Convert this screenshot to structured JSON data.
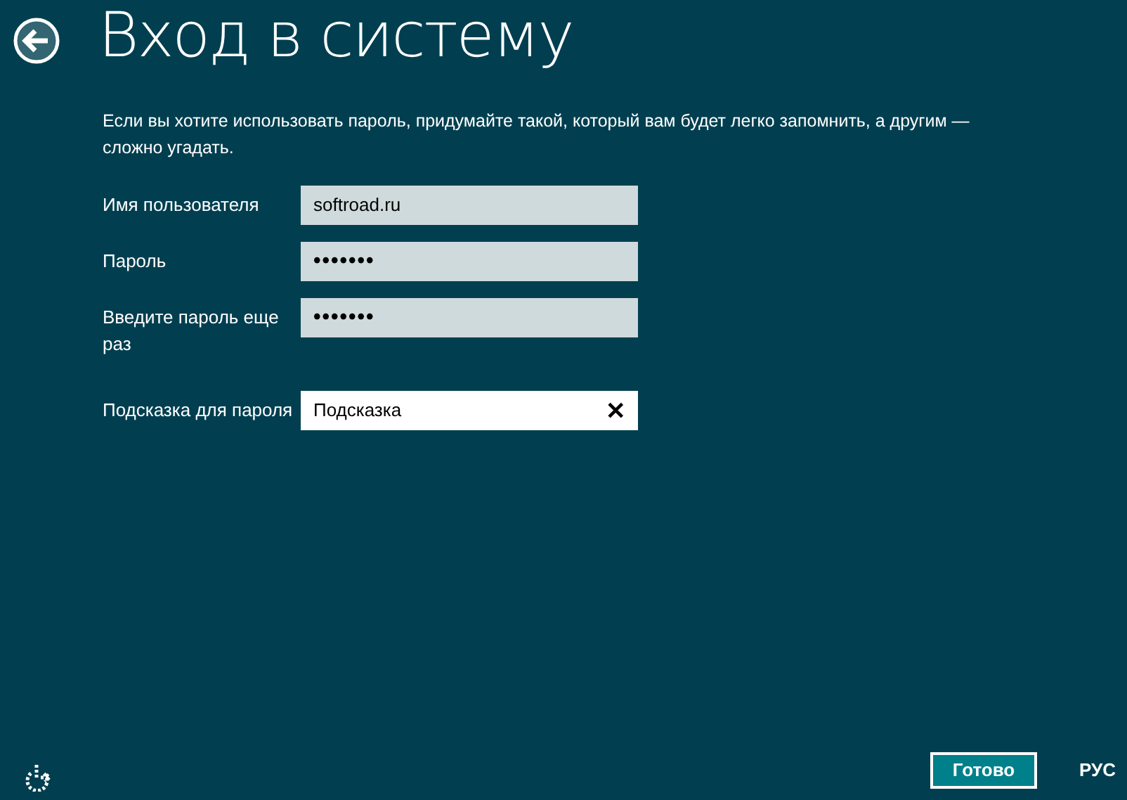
{
  "title": "Вход в систему",
  "description": "Если вы хотите использовать пароль, придумайте такой, который вам будет легко запомнить, а другим — сложно угадать.",
  "fields": [
    {
      "label": "Имя пользователя",
      "value": "softroad.ru",
      "kind": "text",
      "focused": false
    },
    {
      "label": "Пароль",
      "value": "•••••••",
      "kind": "password",
      "focused": false
    },
    {
      "label": "Введите пароль еще раз",
      "value": "•••••••",
      "kind": "password",
      "focused": false
    },
    {
      "label": "Подсказка для пароля",
      "value": "Подсказка",
      "kind": "text",
      "focused": true,
      "clear_button": "✕"
    }
  ],
  "done_button": "Готово",
  "language": "РУС"
}
